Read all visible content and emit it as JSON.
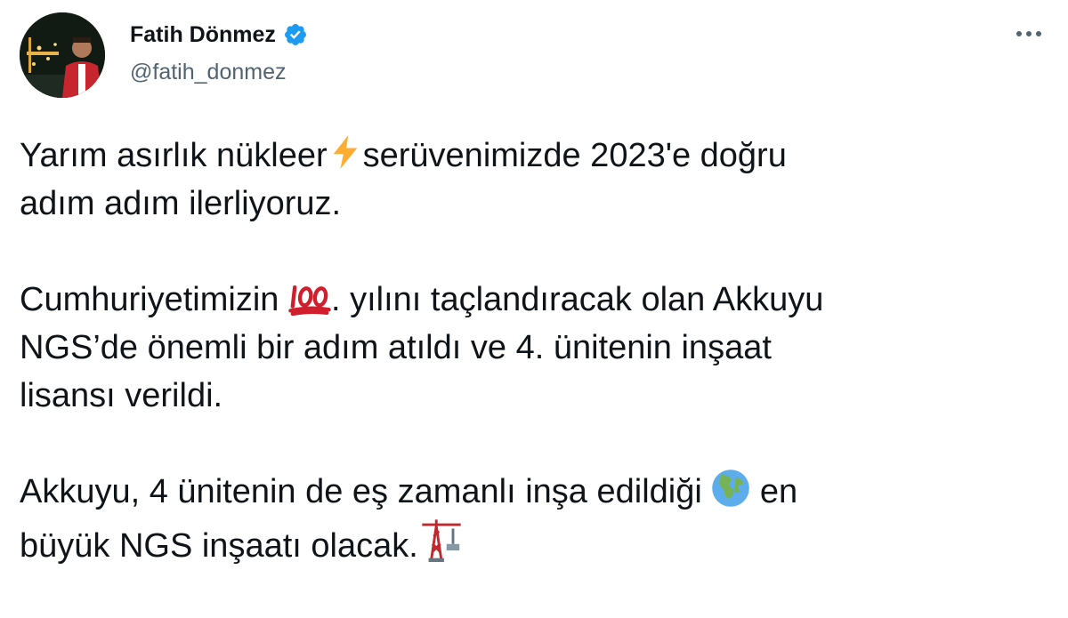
{
  "author": {
    "name": "Fatih Dönmez",
    "handle": "@fatih_donmez",
    "verified": true
  },
  "icons": {
    "verified": "verified-badge-icon",
    "more": "more-options-icon"
  },
  "colors": {
    "verified_blue": "#1d9bf0",
    "secondary_text": "#536471",
    "primary_text": "#0f1419"
  },
  "tweet": {
    "p1": {
      "a": "Yarım asırlık nükleer",
      "emoji1": "⚡",
      "b": "serüvenimizde 2023'e doğru",
      "c": "adım adım ilerliyoruz."
    },
    "p2": {
      "a": "Cumhuriyetimizin",
      "emoji1": "💯",
      "b": ". yılını taçlandıracak olan Akkuyu",
      "c": "NGS’de önemli bir adım atıldı ve 4. ünitenin inşaat",
      "d": "lisansı verildi."
    },
    "p3": {
      "a": "Akkuyu, 4 ünitenin de eş zamanlı inşa edildiği",
      "emoji1": "🌍",
      "b": "en",
      "c": "büyük NGS inşaatı olacak.",
      "emoji2": "🏗️"
    }
  }
}
